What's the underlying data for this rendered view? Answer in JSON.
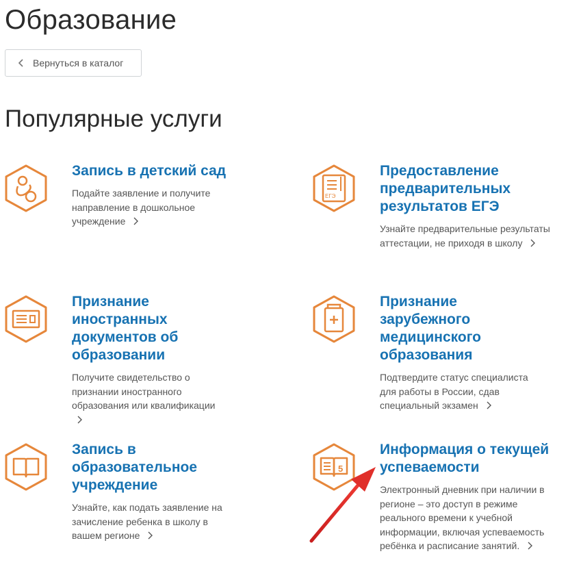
{
  "page": {
    "title": "Образование",
    "section_title": "Популярные услуги"
  },
  "back_button": {
    "label": "Вернуться в каталог"
  },
  "colors": {
    "accent_orange": "#e6873b",
    "link_blue": "#1772b2",
    "annotation_red": "#e02f2a"
  },
  "services": [
    {
      "title": "Запись в детский сад",
      "desc": "Подайте заявление и получите направление в дошкольное учреждение",
      "icon": "pacifier-icon"
    },
    {
      "title": "Предоставление предварительных результатов ЕГЭ",
      "desc": "Узнайте предварительные результаты аттестации, не приходя в школу",
      "icon": "ege-document-icon",
      "icon_text": "ЕГЭ"
    },
    {
      "title": "Признание иностранных документов об образовании",
      "desc": "Получите свидетельство о признании иностранного образования или квалификации",
      "icon": "diploma-icon"
    },
    {
      "title": "Признание зарубежного медицинского образования",
      "desc": "Подтвердите статус специалиста для работы в России, сдав специальный экзамен",
      "icon": "medical-document-icon"
    },
    {
      "title": "Запись в образовательное учреждение",
      "desc": "Узнайте, как подать заявление на зачисление ребенка в школу в вашем регионе",
      "icon": "book-icon"
    },
    {
      "title": "Информация о текущей успеваемости",
      "desc": "Электронный дневник при наличии в регионе – это доступ в режиме реального времени к учебной информации, включая успеваемость ребёнка и расписание занятий.",
      "icon": "diary-grade-icon",
      "icon_text": "5"
    }
  ]
}
